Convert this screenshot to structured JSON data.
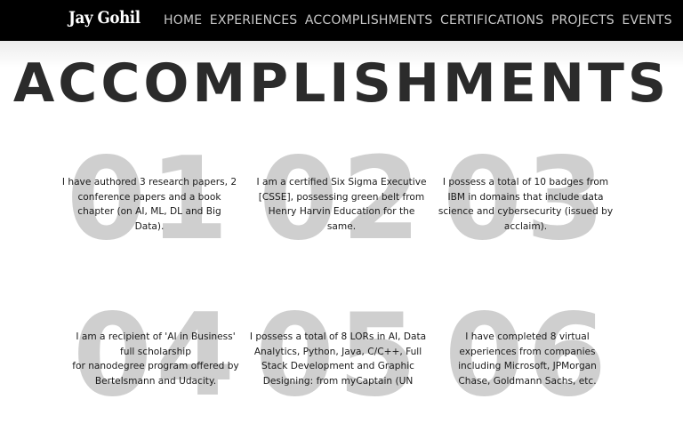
{
  "header": {
    "brand": "Jay Gohil",
    "nav": [
      "HOME",
      "EXPERIENCES",
      "ACCOMPLISHMENTS",
      "CERTIFICATIONS",
      "PROJECTS",
      "EVENTS"
    ]
  },
  "page": {
    "title": "ACCOMPLISHMENTS"
  },
  "accomplishments": [
    {
      "number": "01",
      "text": "I have authored 3 research papers, 2\nconference papers and a book\nchapter (on AI, ML, DL and Big\nData)."
    },
    {
      "number": "02",
      "text": "I am a certified Six Sigma Executive\n[CSSE], possessing green belt from\nHenry Harvin Education for the\nsame."
    },
    {
      "number": "03",
      "text": "I possess a total of 10 badges from\nIBM in domains that include data\nscience and cybersecurity (issued by\nacclaim)."
    },
    {
      "number": "04",
      "text": "I am a recipient of 'AI in Business'\nfull scholarship\nfor nanodegree program offered by\nBertelsmann and Udacity."
    },
    {
      "number": "05",
      "text": "I possess a total of 8 LORs in AI, Data\nAnalytics, Python, Java, C/C++, Full\nStack Development and Graphic\nDesigning: from myCaptain (UN"
    },
    {
      "number": "06",
      "text": "I have completed 8 virtual\nexperiences from companies\nincluding Microsoft, JPMorgan\nChase, Goldmann Sachs, etc."
    }
  ]
}
